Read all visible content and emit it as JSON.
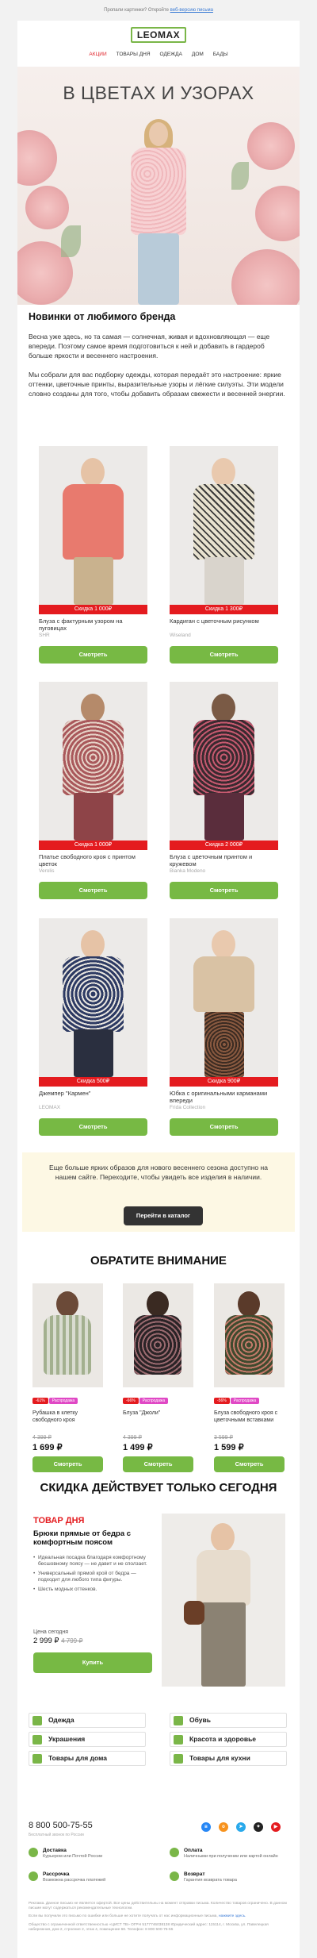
{
  "topbar": {
    "text": "Пропали картинки? Откройте ",
    "link": "веб-версию письма"
  },
  "header": {
    "logo": "LEOMAX",
    "nav": [
      "АКЦИИ",
      "ТОВАРЫ ДНЯ",
      "ОДЕЖДА",
      "ДОМ",
      "БАДЫ"
    ]
  },
  "hero": {
    "title": "В ЦВЕТАХ И УЗОРАХ"
  },
  "intro": {
    "heading": "Новинки от любимого бренда",
    "p1": "Весна уже здесь, но та самая — солнечная, живая и вдохновляющая — еще впереди. Поэтому самое время подготовиться к ней и добавить в гардероб больше яркости и весеннего настроения.",
    "p2": "Мы собрали для вас подборку одежды, которая передаёт это настроение: яркие оттенки, цветочные принты, выразительные узоры и лёгкие силуэты. Эти модели словно созданы для того, чтобы добавить образам свежести и весенней энергии."
  },
  "products": [
    {
      "discount": "Скидка 1 000₽",
      "name": "Блуза с фактурным узором на пуговицах",
      "brand": "SHR",
      "button": "Смотреть",
      "colors": [
        "#e87a6e",
        "#c9b28e"
      ]
    },
    {
      "discount": "Скидка 1 300₽",
      "name": "Кардиган с цветочным рисунком",
      "brand": "Wiseland",
      "button": "Смотреть",
      "colors": [
        "#e8e2cf",
        "#d9d4cc"
      ]
    },
    {
      "discount": "Скидка 1 000₽",
      "name": "Платье свободного кроя с принтом цветок",
      "brand": "Verolis",
      "button": "Смотреть",
      "colors": [
        "#a9585b",
        "#8e4448"
      ]
    },
    {
      "discount": "Скидка 2 000₽",
      "name": "Блуза с цветочным принтом и кружевом",
      "brand": "Bianka Modeno",
      "button": "Смотреть",
      "colors": [
        "#3a2a30",
        "#5a2d3c"
      ]
    },
    {
      "discount": "Скидка 500₽",
      "name": "Джемпер \"Кармен\"",
      "brand": "LEOMAX",
      "button": "Смотреть",
      "colors": [
        "#2d3a63",
        "#2a2f3f"
      ]
    },
    {
      "discount": "Скидка 900₽",
      "name": "Юбка с оригинальными карманами впереди",
      "brand": "Frida Collection",
      "button": "Смотреть",
      "colors": [
        "#d9c2a4",
        "#8a5a40"
      ]
    }
  ],
  "promo": {
    "text": "Еще больше ярких образов для нового весеннего сезона доступно на нашем сайте. Переходите, чтобы увидеть все изделия в наличии.",
    "button": "Перейти в каталог"
  },
  "attention": {
    "title": "ОБРАТИТЕ ВНИМАНИЕ",
    "items": [
      {
        "pct": "-61%",
        "tag": "Распродажа",
        "name": "Рубашка в клетку свободного кроя",
        "old": "4 399 ₽",
        "price": "1 699 ₽",
        "button": "Смотреть",
        "colors": [
          "#a3b08f",
          "#d9dcd0"
        ]
      },
      {
        "pct": "-66%",
        "tag": "Распродажа",
        "name": "Блуза \"Джоли\"",
        "old": "4 399 ₽",
        "price": "1 499 ₽",
        "button": "Смотреть",
        "colors": [
          "#2a2326",
          "#3d3035"
        ]
      },
      {
        "pct": "-56%",
        "tag": "Распродажа",
        "name": "Блуза свободного кроя с цветочными вставками",
        "old": "3 599 ₽",
        "price": "1 599 ₽",
        "button": "Смотреть",
        "colors": [
          "#3f4a2e",
          "#6b4a3a"
        ]
      }
    ]
  },
  "today": {
    "title": "СКИДКА ДЕЙСТВУЕТ ТОЛЬКО СЕГОДНЯ",
    "tag": "ТОВАР ДНЯ",
    "name": "Брюки прямые от бедра с комфортным поясом",
    "features": [
      "Идеальная посадка благодаря комфортному бесшовному поясу — не давит и не сползает.",
      "Универсальный прямой крой от бедра — подходит для любого типа фигуры.",
      "Шесть модных оттенков."
    ],
    "price_label": "Цена сегодня",
    "price": "2 999 ₽",
    "old_price": "4 799 ₽",
    "button": "Купить"
  },
  "categories": [
    "Одежда",
    "Обувь",
    "Украшения",
    "Красота и здоровье",
    "Товары для дома",
    "Товары для кухни"
  ],
  "footer": {
    "phone": "8 800 500-75-55",
    "phone_sub": "Бесплатный звонок по России",
    "social": [
      "vk-icon",
      "ok-icon",
      "telegram-icon",
      "zen-icon",
      "youtube-icon"
    ],
    "features": [
      {
        "title": "Доставка",
        "sub": "Курьером или Почтой России"
      },
      {
        "title": "Оплата",
        "sub": "Наличными при получении или картой онлайн"
      },
      {
        "title": "Рассрочка",
        "sub": "Возможна рассрочка платежей"
      },
      {
        "title": "Возврат",
        "sub": "Гарантия возврата товара"
      }
    ],
    "legal1": "Реклама. Данное письмо не является офертой. Все цены действительны на момент отправки письма. Количество товаров ограничено. В данном письме могут содержаться рекомендательные технологии.",
    "legal2": "Если вы получили это письмо по ошибке или больше не хотите получать от нас информационные письма,",
    "legal_link": "нажмите здесь.",
    "legal3": "Общество с ограниченной ответственностью «ЦИСТ ТВ» ОГРН 5177746038138 Юридический адрес: 115114, г. Москва, ул. Павелецкая набережная, дом 2, строение 2, этаж 4, помещение 68. Телефон: 8 800 500-75-55"
  },
  "colors": {
    "accent": "#7ab648",
    "sale": "#e41b1f",
    "pink_badge": "#e048c5"
  }
}
